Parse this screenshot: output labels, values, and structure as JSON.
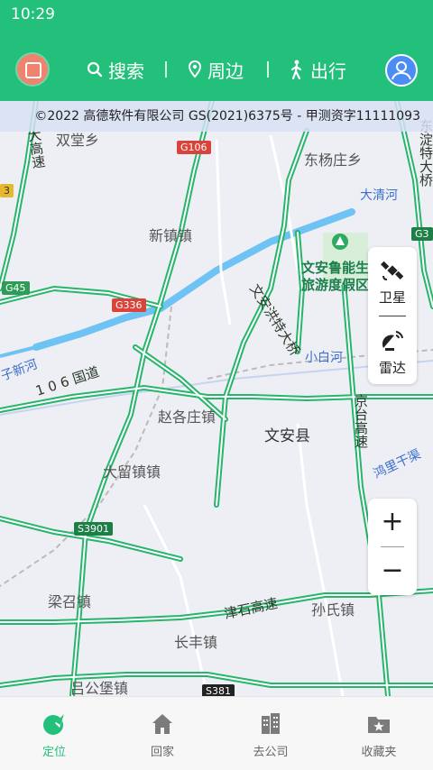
{
  "status_bar": {
    "time": "10:29"
  },
  "header": {
    "search_label": "搜索",
    "nearby_label": "周边",
    "travel_label": "出行"
  },
  "map": {
    "copyright": "©2022 高德软件有限公司 GS(2021)6375号 - 甲测资字11111093",
    "places": {
      "shuangtang": "双堂乡",
      "dongyangzhuang": "东杨庄乡",
      "xinzhen": "新镇镇",
      "wenan_park": "文安鲁能生\n旅游度假区",
      "zhaogezhuang": "赵各庄镇",
      "wenan_county": "文安县",
      "daliu": "大留镇镇",
      "liangzhao": "梁召镇",
      "sunshi": "孙氏镇",
      "changfeng": "长丰镇",
      "lvgongbao": "吕公堡镇"
    },
    "waters": {
      "daqing": "大清河",
      "xiaobai": "小白河",
      "zixin": "子新河",
      "hongli": "鸿里干渠"
    },
    "roads": {
      "da_gao": "大高速",
      "guodao106": "1 0 6 国道",
      "wenan_bridge": "文安洪特大桥",
      "jingtai": "京台高速",
      "jinshi": "津石高速",
      "dong_bridge": "东淀特大桥"
    },
    "shields": {
      "g106": "G106",
      "g336": "G336",
      "g45": "G45",
      "s3901": "S3901",
      "s381": "S381",
      "g3": "G3",
      "left_3": "3"
    }
  },
  "layers": {
    "satellite_label": "卫星",
    "radar_label": "雷达"
  },
  "zoom": {
    "in_label": "+",
    "out_label": "−"
  },
  "tabbar": {
    "tabs": [
      {
        "label": "定位"
      },
      {
        "label": "回家"
      },
      {
        "label": "去公司"
      },
      {
        "label": "收藏夹"
      }
    ]
  },
  "colors": {
    "brand": "#23c07c",
    "road": "#26b56b",
    "water": "#6ec3f4"
  }
}
